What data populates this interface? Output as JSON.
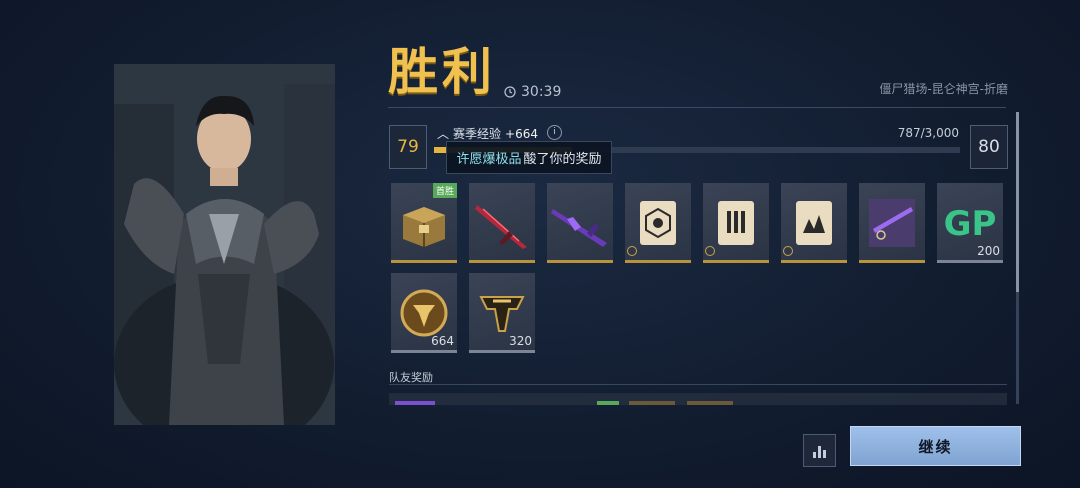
{
  "result": {
    "title": "胜利",
    "timer": "30:39",
    "location": "僵尸猎场-昆仑神宫-折磨"
  },
  "progress": {
    "current_level": "79",
    "next_level": "80",
    "xp_label": "赛季经验",
    "xp_gain": "+664",
    "xp_value": "787/3,000",
    "xp_fraction": 0.262,
    "info_icon": "i"
  },
  "tooltip": {
    "highlight": "许愿爆极品",
    "rest": "酸了你的奖励"
  },
  "rewards": [
    {
      "icon": "gold-crate-icon",
      "tag": "首胜",
      "count": ""
    },
    {
      "icon": "red-blade-icon",
      "tag": "",
      "count": ""
    },
    {
      "icon": "purple-weapon-icon",
      "tag": "",
      "count": ""
    },
    {
      "icon": "sigil-card-icon",
      "tag": "",
      "count": ""
    },
    {
      "icon": "ammo-card-icon",
      "tag": "",
      "count": ""
    },
    {
      "icon": "burst-card-icon",
      "tag": "",
      "count": ""
    },
    {
      "icon": "weapon-blueprint-icon",
      "tag": "",
      "count": ""
    },
    {
      "icon": "gp-icon",
      "tag": "",
      "count": "200",
      "label": "GP"
    },
    {
      "icon": "gold-emblem-icon",
      "tag": "",
      "count": "664"
    },
    {
      "icon": "tier-emblem-icon",
      "tag": "",
      "count": "320"
    }
  ],
  "teammates": {
    "label": "队友奖励"
  },
  "actions": {
    "continue_label": "继续",
    "stats_icon": "bar-chart-icon"
  },
  "colors": {
    "title_gold": "#f1c14f",
    "xp_fill": "#e5b43e",
    "tooltip_highlight": "#8fe0ec",
    "continue_bg": "#9fc0ea"
  }
}
